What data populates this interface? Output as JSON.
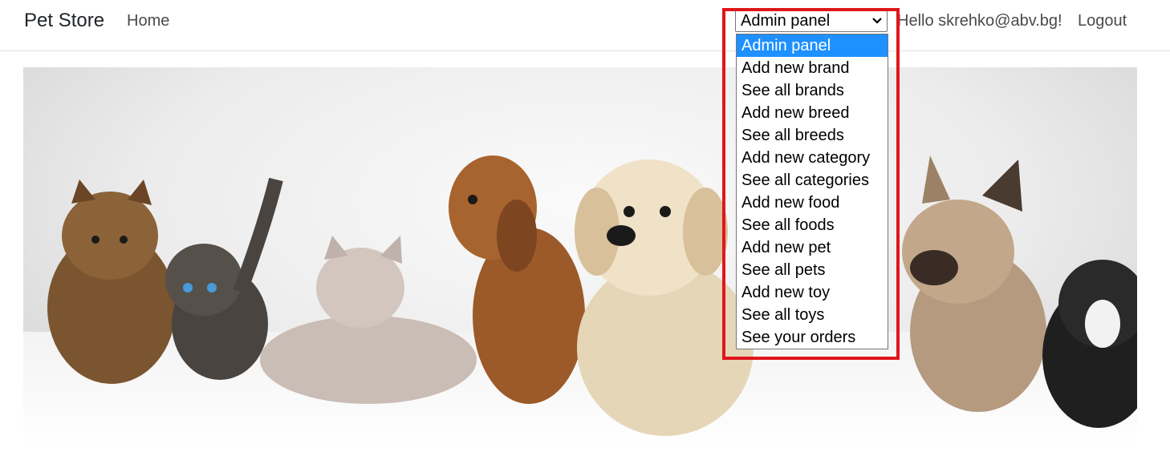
{
  "navbar": {
    "brand": "Pet Store",
    "home": "Home",
    "greeting": "Hello skrehko@abv.bg!",
    "logout": "Logout"
  },
  "admin_select": {
    "selected": "Admin panel",
    "options": [
      "Admin panel",
      "Add new brand",
      "See all brands",
      "Add new breed",
      "See all breeds",
      "Add new category",
      "See all categories",
      "Add new food",
      "See all foods",
      "Add new pet",
      "See all pets",
      "Add new toy",
      "See all toys",
      "See your orders"
    ]
  },
  "hero": {
    "image": "banner photo of puppies and kittens on white background"
  },
  "colors": {
    "highlight": "#e0161c",
    "option_selected": "#1e90ff"
  }
}
